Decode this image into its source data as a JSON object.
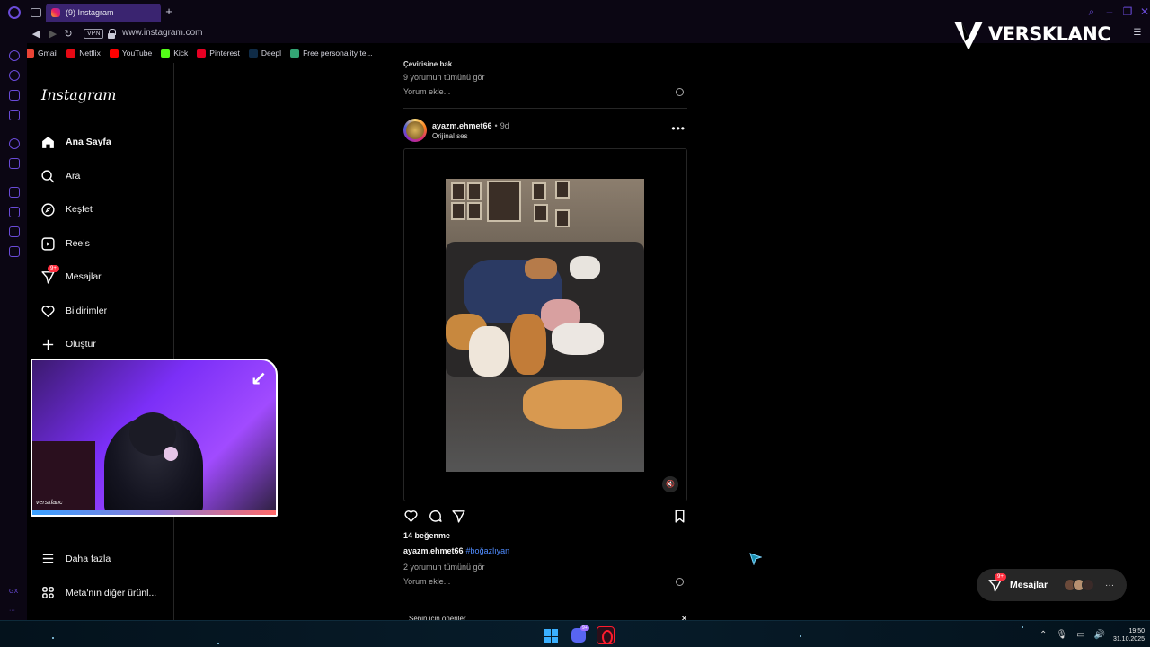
{
  "browser": {
    "tab_title": "(9) Instagram",
    "new_tab": "+",
    "url": "www.instagram.com",
    "vpn_label": "VPN",
    "bookmarks": [
      {
        "label": "Gmail",
        "color": "#ea4335"
      },
      {
        "label": "Netflix",
        "color": "#e50914"
      },
      {
        "label": "YouTube",
        "color": "#ff0000"
      },
      {
        "label": "Kick",
        "color": "#53fc18"
      },
      {
        "label": "Pinterest",
        "color": "#e60023"
      },
      {
        "label": "Deepl",
        "color": "#0f2b46"
      },
      {
        "label": "Free personality te...",
        "color": "#33a474"
      }
    ],
    "rail_text": "GX"
  },
  "instagram": {
    "logo": "Instagram",
    "nav": [
      {
        "label": "Ana Sayfa"
      },
      {
        "label": "Ara"
      },
      {
        "label": "Keşfet"
      },
      {
        "label": "Reels"
      },
      {
        "label": "Mesajlar",
        "badge": "9+"
      },
      {
        "label": "Bildirimler"
      },
      {
        "label": "Oluştur"
      }
    ],
    "nav_bottom": [
      {
        "label": "Daha fazla"
      },
      {
        "label": "Meta'nın diğer ürünl..."
      }
    ]
  },
  "webcam": {
    "tag": "versklanc"
  },
  "feed": {
    "prev_post": {
      "truncated_text": "Çevirisine bak",
      "view_comments": "9 yorumun tümünü gör",
      "add_comment": "Yorum ekle..."
    },
    "post": {
      "username": "ayazm.ehmet66",
      "separator": "•",
      "time": "9d",
      "audio": "Orijinal ses",
      "likes": "14 beğenme",
      "caption_user": "ayazm.ehmet66",
      "caption_tag": "#boğazlıyan",
      "view_comments": "2 yorumun tümünü gör",
      "add_comment": "Yorum ekle..."
    },
    "suggestions_title": "Senin için öneriler",
    "close": "×"
  },
  "floating_messages": {
    "label": "Mesajlar",
    "badge": "9+"
  },
  "watermark": {
    "brand": "VERSKLANC"
  },
  "taskbar": {
    "discord_badge": "9+",
    "time": "19:50",
    "date": "31.10.2025"
  },
  "colors": {
    "accent": "#6a4bd8",
    "instagram_blue": "#4f8cff",
    "notification_red": "#ff3040"
  }
}
